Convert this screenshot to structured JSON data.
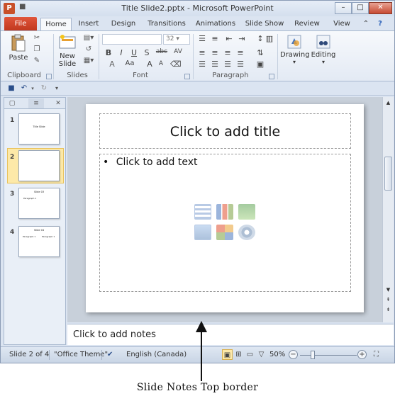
{
  "window": {
    "title": "Title Slide2.pptx - Microsoft PowerPoint",
    "app_icon_letter": "P",
    "controls": {
      "minimize": "–",
      "maximize": "□",
      "close": "✕"
    }
  },
  "tabs": {
    "file": "File",
    "items": [
      "Home",
      "Insert",
      "Design",
      "Transitions",
      "Animations",
      "Slide Show",
      "Review",
      "View"
    ],
    "active": "Home"
  },
  "ribbon": {
    "groups": [
      "Clipboard",
      "Slides",
      "Font",
      "Paragraph"
    ],
    "paste_label": "Paste",
    "new_slide_label": "New Slide",
    "new_slide_line1": "New",
    "new_slide_line2": "Slide",
    "font_size": "32",
    "drawing_label": "Drawing",
    "editing_label": "Editing",
    "format_buttons": [
      "B",
      "I",
      "U",
      "S",
      "abc",
      "AV",
      "Aa"
    ],
    "grow_font": "A",
    "shrink_font": "A"
  },
  "left_panel": {
    "thumbnails": [
      {
        "num": "1",
        "title": "Title Slide",
        "body": ""
      },
      {
        "num": "2",
        "title": "",
        "body": ""
      },
      {
        "num": "3",
        "title": "Slide 03",
        "body": "Paragraph 1"
      },
      {
        "num": "4",
        "title": "Slide 04",
        "body": "Paragraph 1"
      }
    ],
    "selected_index": 2
  },
  "slide": {
    "title_placeholder": "Click to add title",
    "body_placeholder": "Click to add text",
    "bullet": "•"
  },
  "notes": {
    "placeholder": "Click to add notes"
  },
  "status": {
    "slide_info": "Slide 2 of 4",
    "theme": "\"Office Theme\"",
    "language": "English (Canada)",
    "zoom": "50%",
    "zoom_out": "−",
    "zoom_in": "+"
  },
  "annotation": {
    "caption": "Slide Notes Top border"
  },
  "colors": {
    "file_tab": "#c1391f",
    "selection": "#fde9a8",
    "ribbon_bg": "#f7f9fc",
    "window_bg": "#dbe4f1"
  }
}
